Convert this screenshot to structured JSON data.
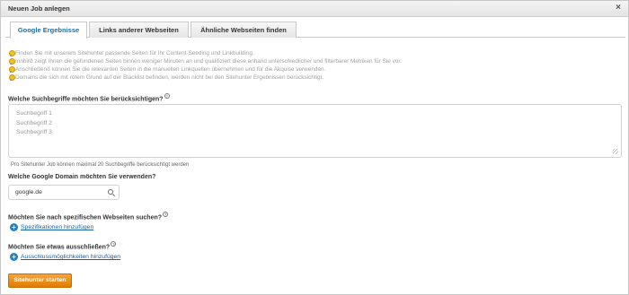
{
  "dialog": {
    "title": "Neuen Job anlegen",
    "close_symbol": "×"
  },
  "tabs": [
    {
      "label": "Google Ergebnisse",
      "active": true
    },
    {
      "label": "Links anderer Webseiten",
      "active": false
    },
    {
      "label": "Ähnliche Webseiten finden",
      "active": false
    }
  ],
  "tips": [
    "Finden Sie mit unserem Sitehunter passende Seiten für Ihr Content-Seeding und Linkbuilding.",
    "Innbird zeigt Ihnen die gefundenen Seiten binnen weniger Minuten an und qualifiziert diese anhand unterschiedlicher und filterbarer Metriken für Sie vor.",
    "Anschließend können Sie die relevanten Seiten in die manuellen Linkquellen übernehmen und für die Akquise verwenden.",
    "Domains die sich mit rotem Grund auf der Blacklist befinden, werden nicht bei den Sitehunter Ergebnissen berücksichtigt."
  ],
  "keywords": {
    "label": "Welche Suchbegriffe möchten Sie berücksichtigen?",
    "help_symbol": "?",
    "placeholder_lines": [
      "Suchbegriff 1",
      "Suchbegriff 2",
      "Suchbegriff 3"
    ],
    "hint": "Pro Sitehunter Job können maximal 20 Suchbegriffe berücksichtigt werden"
  },
  "domain": {
    "label": "Welche Google Domain möchten Sie verwenden?",
    "value": "google.de"
  },
  "specific": {
    "label": "Möchten Sie nach spezifischen Webseiten suchen?",
    "help_symbol": "?",
    "add_symbol": "+",
    "link": "Spezifikationen hinzufügen"
  },
  "exclude": {
    "label": "Möchten Sie etwas ausschließen?",
    "help_symbol": "?",
    "add_symbol": "+",
    "link": "Ausschlussmöglichkeiten hinzufügen"
  },
  "start_button": "Sitehunter starten",
  "colors": {
    "accent": "#e8860e",
    "link": "#1a5fa0",
    "tab_active": "#1a6ea8",
    "bulb": "#f3c21b"
  }
}
